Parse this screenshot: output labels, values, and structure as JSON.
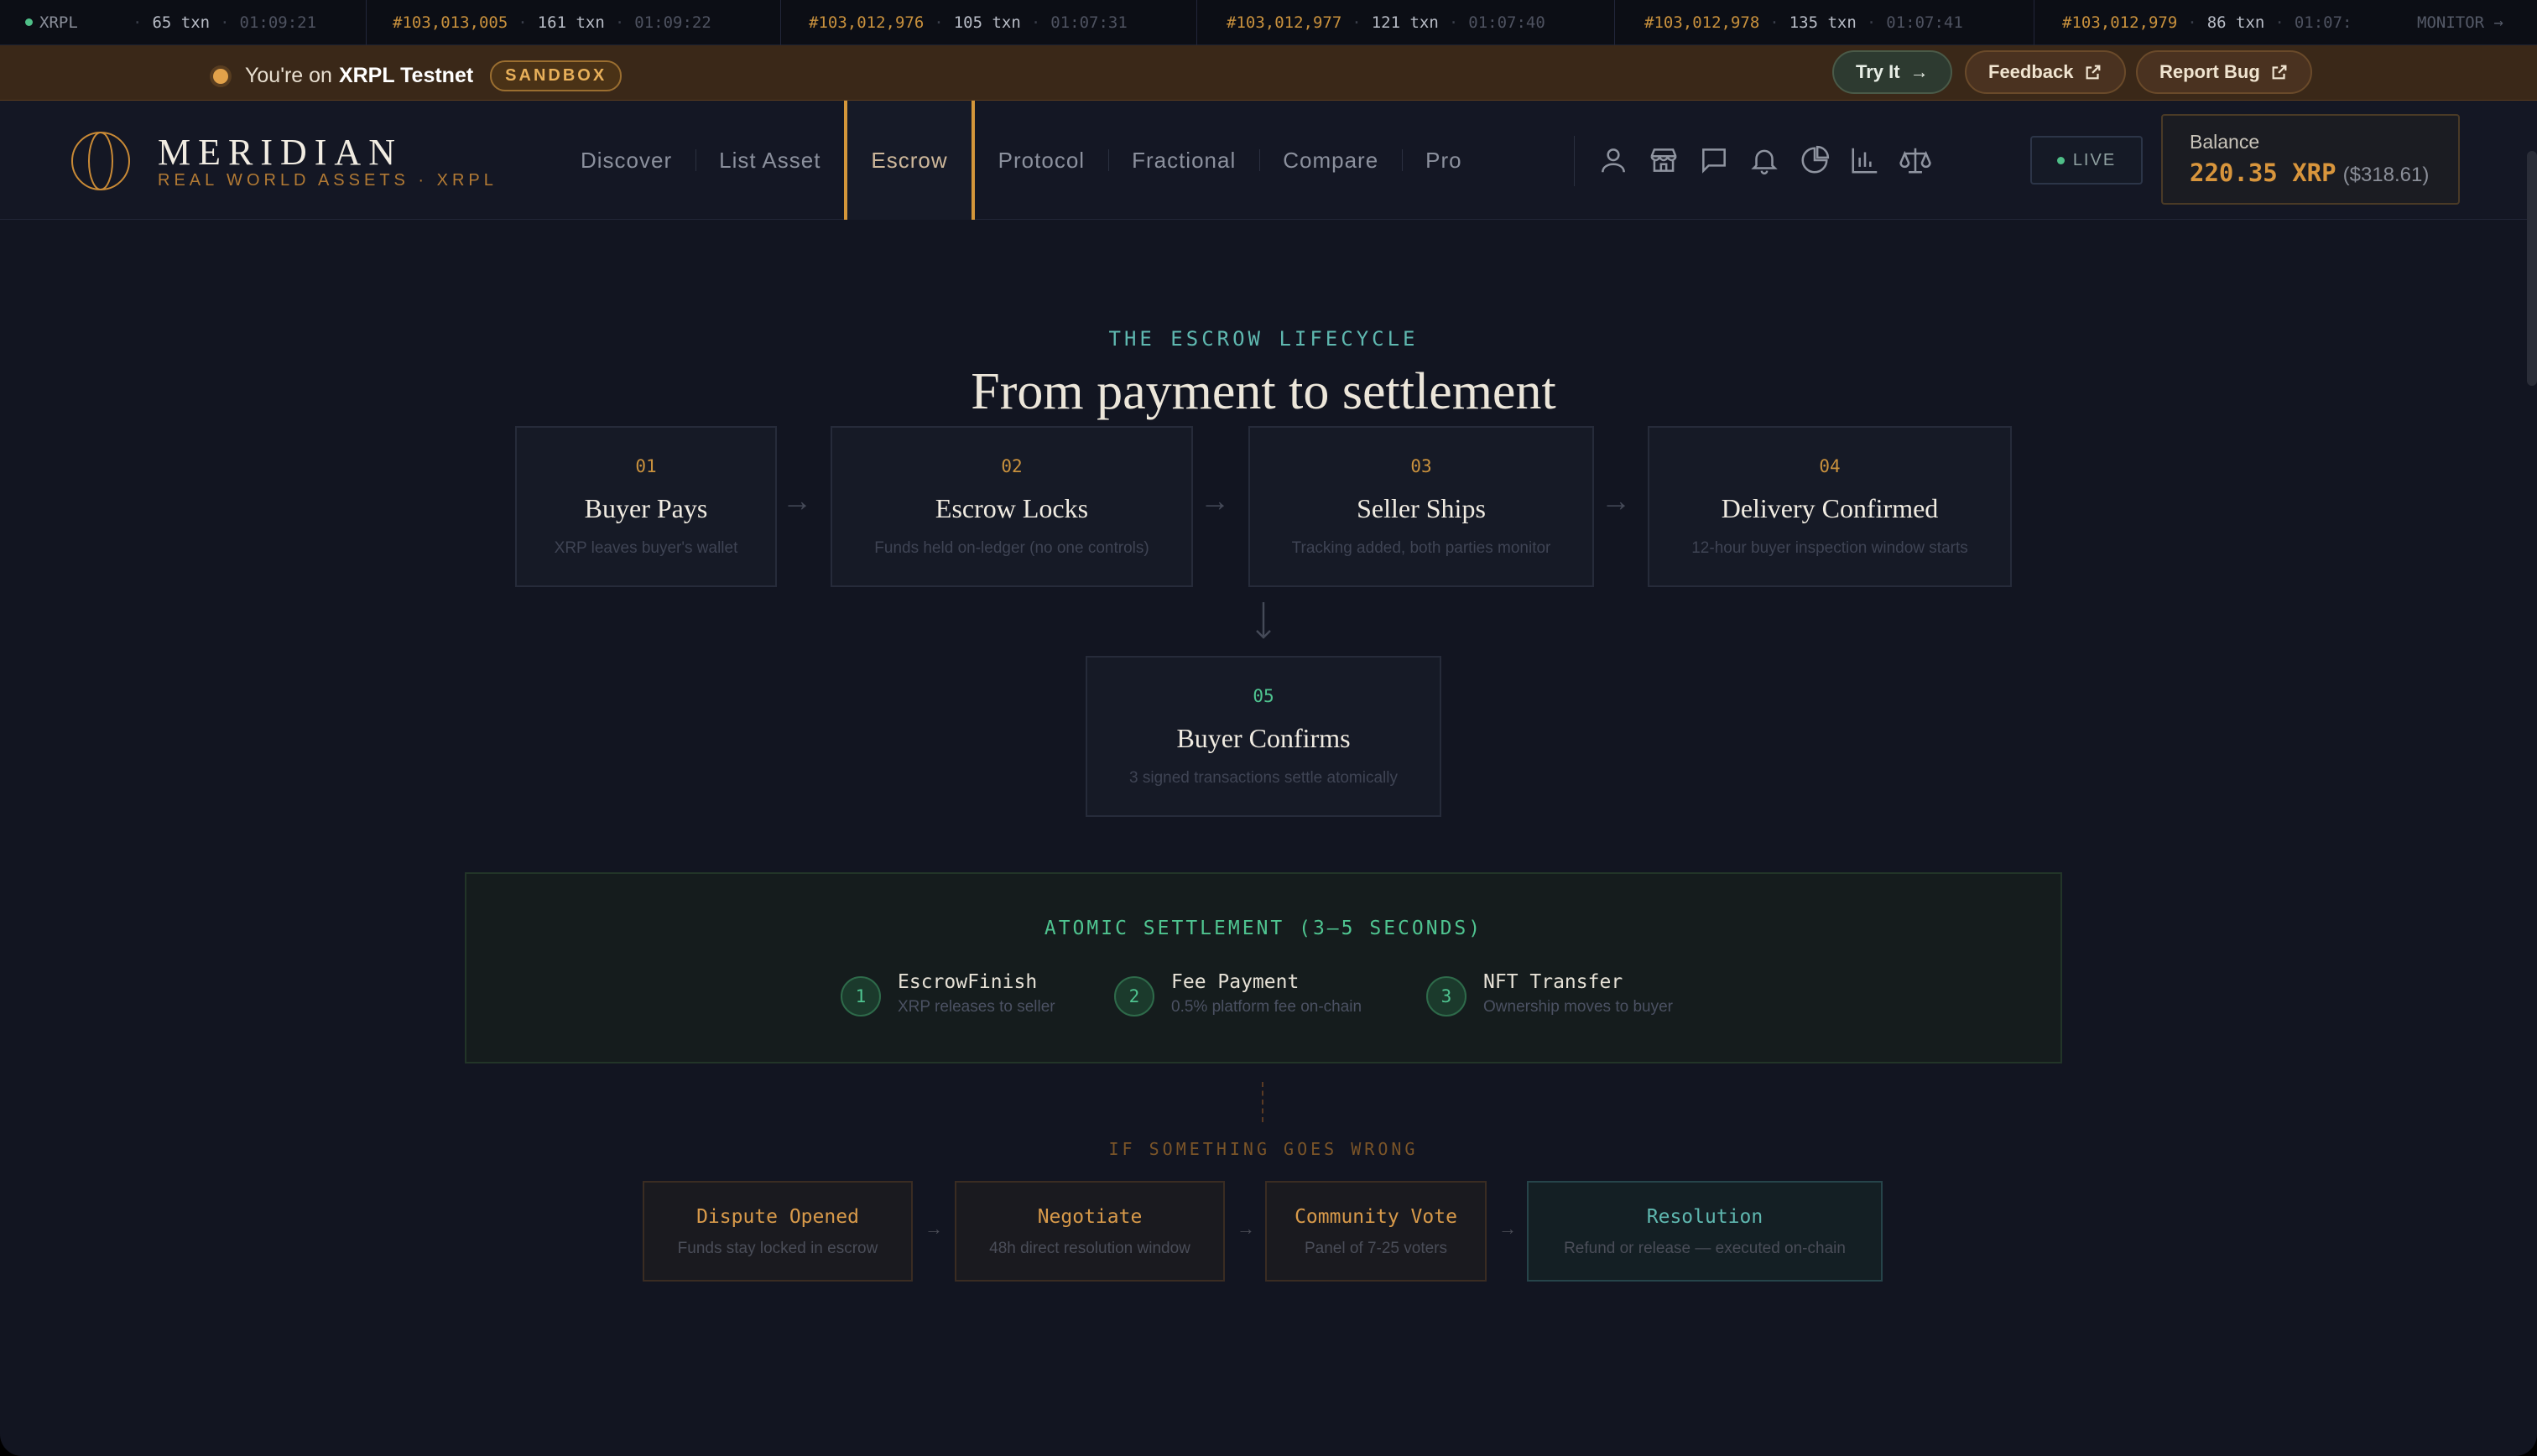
{
  "ticker": {
    "network": "XRPL",
    "items": [
      {
        "ledger": "",
        "txn": "65 txn",
        "time": "01:09:21"
      },
      {
        "ledger": "#103,013,005",
        "txn": "161 txn",
        "time": "01:09:22"
      },
      {
        "ledger": "#103,012,976",
        "txn": "105 txn",
        "time": "01:07:31"
      },
      {
        "ledger": "#103,012,977",
        "txn": "121 txn",
        "time": "01:07:40"
      },
      {
        "ledger": "#103,012,978",
        "txn": "135 txn",
        "time": "01:07:41"
      },
      {
        "ledger": "#103,012,979",
        "txn": "86 txn",
        "time": "01:07:"
      }
    ],
    "monitor": "MONITOR →"
  },
  "sandbox": {
    "prefix": "You're on",
    "network": "XRPL Testnet",
    "badge": "SANDBOX",
    "try_label": "Try It",
    "feedback_label": "Feedback",
    "report_label": "Report Bug"
  },
  "brand": {
    "name": "MERIDIAN",
    "tagline": "REAL WORLD ASSETS · XRPL"
  },
  "nav": [
    {
      "label": "Discover"
    },
    {
      "label": "List Asset"
    },
    {
      "label": "Escrow"
    },
    {
      "label": "Protocol"
    },
    {
      "label": "Fractional"
    },
    {
      "label": "Compare"
    },
    {
      "label": "Pro"
    }
  ],
  "header_icons": [
    "user-icon",
    "store-icon",
    "chat-icon",
    "bell-icon",
    "pie-chart-icon",
    "bar-chart-icon",
    "scale-icon"
  ],
  "live_label": "LIVE",
  "balance": {
    "label": "Balance",
    "amount": "220.35 XRP",
    "usd": "($318.61)"
  },
  "lifecycle": {
    "eyebrow": "THE ESCROW LIFECYCLE",
    "title": "From payment to settlement",
    "steps": [
      {
        "num": "01",
        "title": "Buyer Pays",
        "desc": "XRP leaves buyer's wallet"
      },
      {
        "num": "02",
        "title": "Escrow Locks",
        "desc": "Funds held on-ledger (no one controls)"
      },
      {
        "num": "03",
        "title": "Seller Ships",
        "desc": "Tracking added, both parties monitor"
      },
      {
        "num": "04",
        "title": "Delivery Confirmed",
        "desc": "12-hour buyer inspection window starts"
      },
      {
        "num": "05",
        "title": "Buyer Confirms",
        "desc": "3 signed transactions settle atomically"
      }
    ]
  },
  "atomic": {
    "title": "ATOMIC SETTLEMENT (3–5 SECONDS)",
    "txs": [
      {
        "n": "1",
        "name": "EscrowFinish",
        "desc": "XRP releases to seller"
      },
      {
        "n": "2",
        "name": "Fee Payment",
        "desc": "0.5% platform fee on-chain"
      },
      {
        "n": "3",
        "name": "NFT Transfer",
        "desc": "Ownership moves to buyer"
      }
    ]
  },
  "dispute": {
    "label": "IF SOMETHING GOES WRONG",
    "steps": [
      {
        "title": "Dispute Opened",
        "desc": "Funds stay locked in escrow"
      },
      {
        "title": "Negotiate",
        "desc": "48h direct resolution window"
      },
      {
        "title": "Community Vote",
        "desc": "Panel of 7-25 voters"
      },
      {
        "title": "Resolution",
        "desc": "Refund or release — executed on-chain"
      }
    ]
  },
  "colors": {
    "accent": "#d4963a",
    "green": "#4fc490",
    "teal": "#5fb8b0",
    "bg": "#121521"
  }
}
